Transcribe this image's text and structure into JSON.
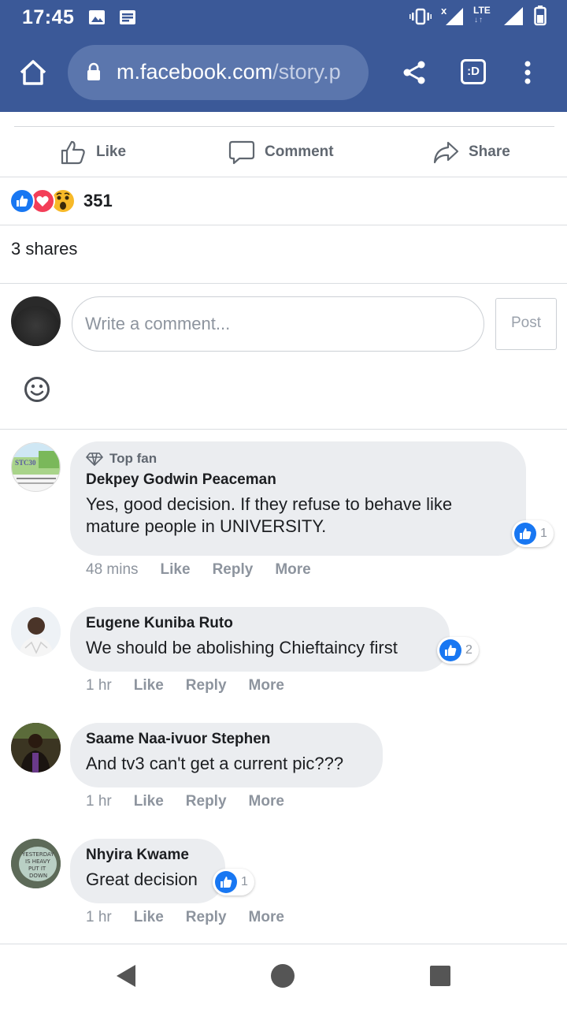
{
  "status_bar": {
    "time": "17:45",
    "network": "LTE"
  },
  "browser": {
    "url_domain": "m.facebook.com",
    "url_path": "/story.p",
    "tab_label": ":D"
  },
  "actions": {
    "like": "Like",
    "comment": "Comment",
    "share": "Share"
  },
  "reactions": {
    "count": "351",
    "types": [
      "like",
      "love",
      "wow"
    ]
  },
  "shares": "3 shares",
  "composer": {
    "placeholder": "Write a comment...",
    "post_label": "Post"
  },
  "comments": [
    {
      "badge": "Top fan",
      "author": "Dekpey Godwin Peaceman",
      "text": "Yes, good decision. If they refuse to behave like mature people in UNIVERSITY.",
      "likes": "1",
      "time": "48 mins",
      "like": "Like",
      "reply": "Reply",
      "more": "More"
    },
    {
      "author": "Eugene Kuniba Ruto",
      "text": "We should be abolishing Chieftaincy first",
      "likes": "2",
      "time": "1 hr",
      "like": "Like",
      "reply": "Reply",
      "more": "More"
    },
    {
      "author": "Saame Naa-ivuor Stephen",
      "text": "And tv3 can't get a current pic???",
      "time": "1 hr",
      "like": "Like",
      "reply": "Reply",
      "more": "More"
    },
    {
      "author": "Nhyira Kwame",
      "text": "Great decision",
      "likes": "1",
      "time": "1 hr",
      "like": "Like",
      "reply": "Reply",
      "more": "More"
    }
  ],
  "colors": {
    "facebook_blue": "#3b5998",
    "like_blue": "#1877f2",
    "love_red": "#f33e58",
    "wow_yellow": "#f7b928"
  }
}
